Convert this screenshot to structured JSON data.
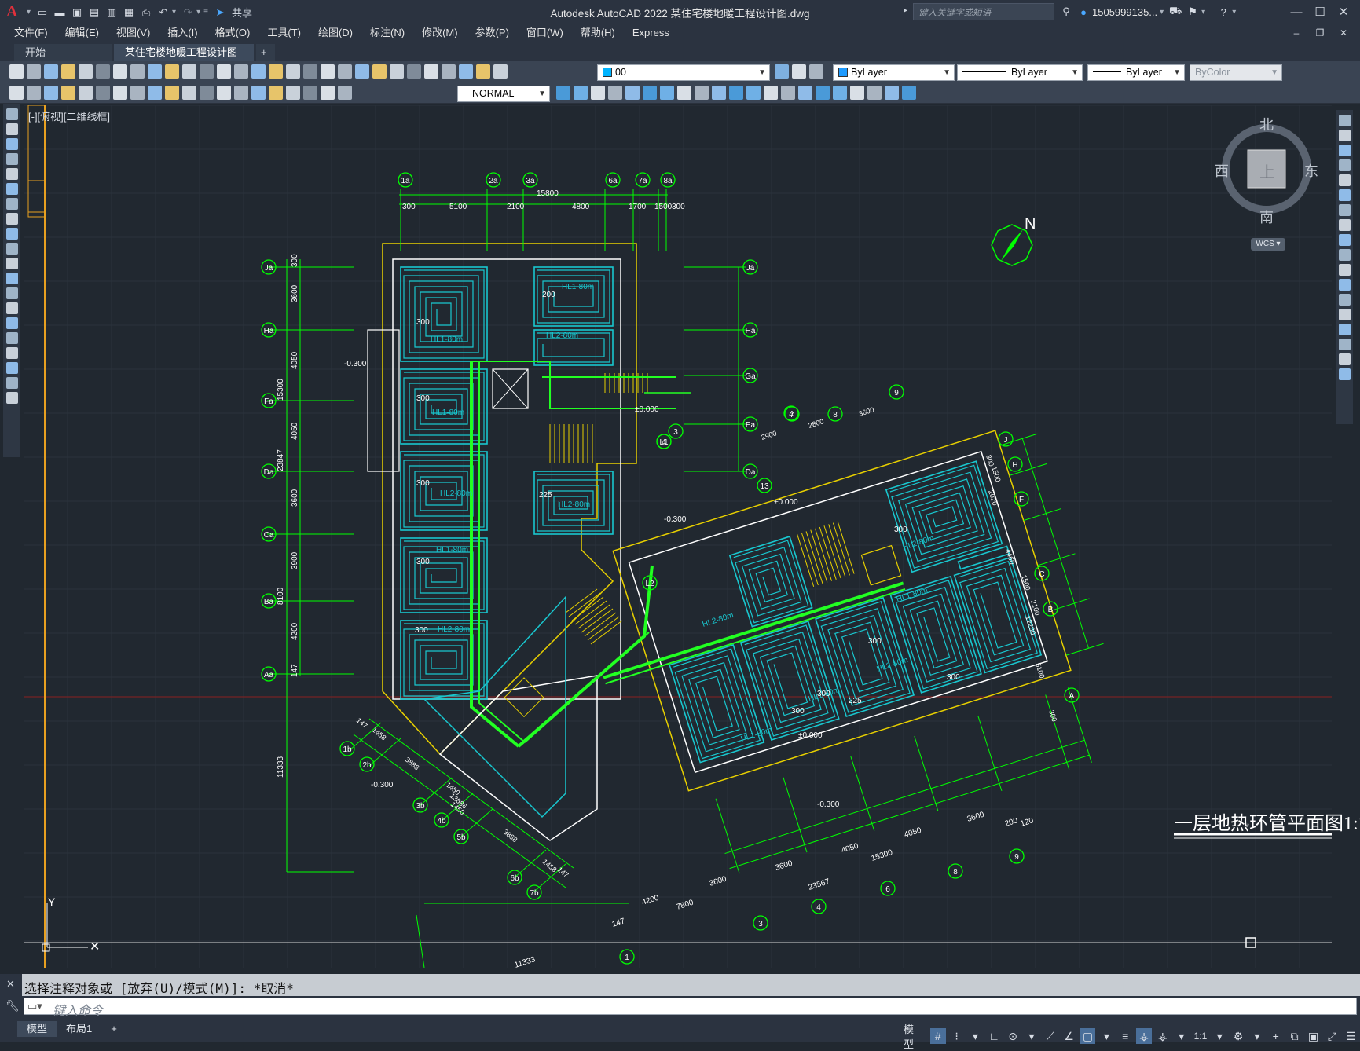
{
  "app": {
    "logo": "A",
    "window_title": "Autodesk AutoCAD 2022    某住宅楼地暖工程设计图.dwg",
    "share_label": "共享",
    "search_placeholder": "键入关键字或短语",
    "user_name": "1505999135..."
  },
  "menu": [
    "文件(F)",
    "编辑(E)",
    "视图(V)",
    "插入(I)",
    "格式(O)",
    "工具(T)",
    "绘图(D)",
    "标注(N)",
    "修改(M)",
    "参数(P)",
    "窗口(W)",
    "帮助(H)",
    "Express"
  ],
  "tabs": [
    {
      "label": "开始",
      "active": false
    },
    {
      "label": "某住宅楼地暖工程设计图*",
      "active": true
    }
  ],
  "toolbar": {
    "layer_value": "00",
    "color_value": "ByLayer",
    "linetype_value": "ByLayer",
    "lineweight_value": "ByLayer",
    "plotstyle_value": "ByColor",
    "dimstyle_value": "NORMAL"
  },
  "viewport": {
    "label": "[-][俯视][二维线框]"
  },
  "viewcube": {
    "north": "北",
    "south": "南",
    "west": "西",
    "east": "东",
    "face": "上",
    "wcs": "WCS"
  },
  "drawing": {
    "north_label": "N",
    "title": "一层地热环管平面图1:1",
    "ucs_label": "Y",
    "axis_top": [
      "1a",
      "2a",
      "3a",
      "6a",
      "7a",
      "8a"
    ],
    "axis_left": [
      "Ja",
      "Ha",
      "Fa",
      "Da",
      "Ca",
      "Ba",
      "Aa"
    ],
    "axis_right_a": [
      "Ja",
      "Ha",
      "Ga",
      "Ea",
      "Da"
    ],
    "axis_right_b": [
      "J",
      "H",
      "F",
      "C",
      "B",
      "A"
    ],
    "axis_bottom": [
      "1",
      "3",
      "4",
      "6",
      "8",
      "9"
    ],
    "axis_diag": [
      "1b",
      "2b",
      "3b",
      "4b",
      "5b",
      "6b",
      "7b"
    ],
    "dims_top": [
      "300",
      "5100",
      "2100",
      "4800",
      "1700",
      "1500",
      "300",
      "15800"
    ],
    "dims_left": [
      "300",
      "3600",
      "4050",
      "4050",
      "3600",
      "3900",
      "4200",
      "147",
      "23847",
      "15300",
      "8100",
      "11333"
    ],
    "dims_bottom": [
      "147",
      "4200",
      "3600",
      "3600",
      "4050",
      "4050",
      "3600",
      "200",
      "120",
      "7800",
      "23567",
      "15300",
      "11333"
    ],
    "dims_diag": [
      "147",
      "1458",
      "3888",
      "1450",
      "1450",
      "13686",
      "3888",
      "1458",
      "147"
    ],
    "dims_right": [
      "2900",
      "2800",
      "3600",
      "300",
      "1500",
      "2020",
      "4460",
      "1500",
      "2100",
      "12280",
      "5100",
      "300"
    ],
    "elevations": [
      "-0.300",
      "-0.300",
      "-0.300",
      "-0.300",
      "±0.000",
      "±0.000",
      "±0.000"
    ],
    "loop_labels": [
      "HL1-80m",
      "HL1-80m",
      "HL2-80m",
      "HL1-80m",
      "HL2-80m",
      "HL2-80m",
      "HL2-80m",
      "HL1-80m",
      "HL2-80m",
      "HL1-80m",
      "HL1-80m",
      "HL2-80m",
      "HL1-80m",
      "HL2-80m"
    ],
    "spacings": [
      "300",
      "200",
      "300",
      "300",
      "225",
      "300",
      "300",
      "300",
      "300",
      "225",
      "300",
      "300",
      "300"
    ]
  },
  "command": {
    "history": "选择注释对象或 [放弃(U)/模式(M)]: *取消*",
    "placeholder": "键入命令"
  },
  "status": {
    "layout_tabs": [
      "模型",
      "布局1"
    ],
    "model_label": "模型",
    "scale": "1:1"
  },
  "colors": {
    "background": "#212830",
    "chrome": "#2b3340",
    "wall": "#ffffff",
    "heating_loop": "#19c7cf",
    "supply_pipe": "#22ff22",
    "axis": "#00ff00",
    "yellow": "#e8d000",
    "red_axis": "#b02020"
  }
}
